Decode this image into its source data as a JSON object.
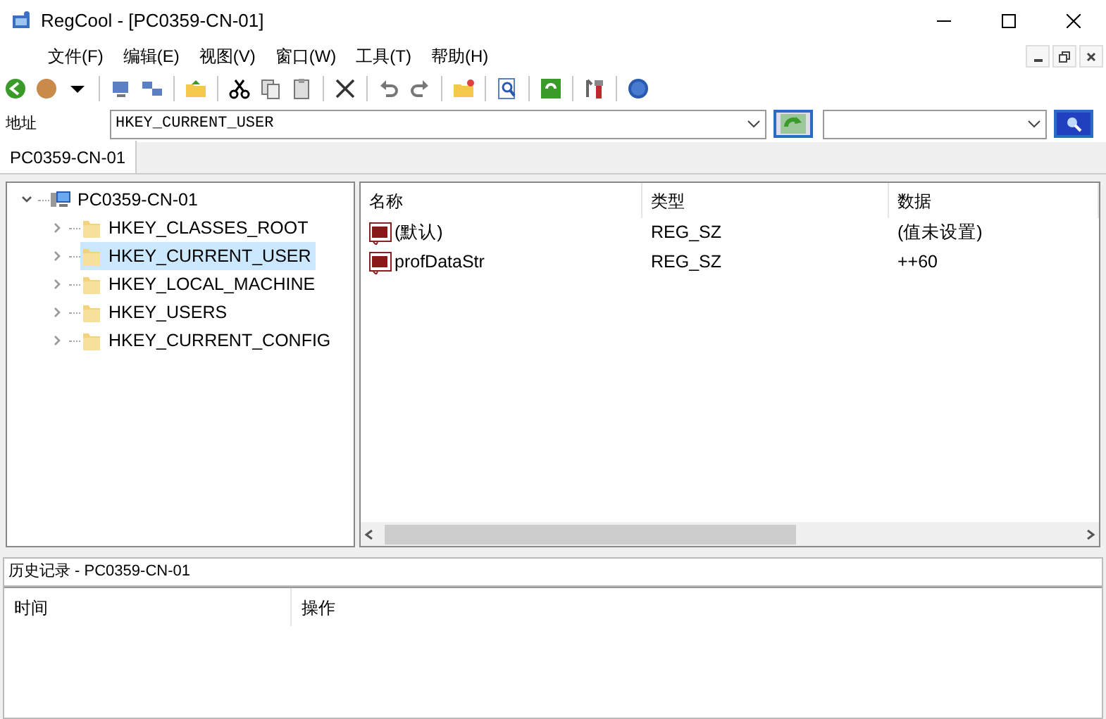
{
  "window": {
    "title": "RegCool - [PC0359-CN-01]"
  },
  "menu": [
    "文件(F)",
    "编辑(E)",
    "视图(V)",
    "窗口(W)",
    "工具(T)",
    "帮助(H)"
  ],
  "address": {
    "label": "地址",
    "value": "HKEY_CURRENT_USER"
  },
  "tabs": [
    {
      "label": "PC0359-CN-01",
      "selected": true
    }
  ],
  "tree": [
    {
      "label": "PC0359-CN-01",
      "kind": "computer",
      "expanded": true,
      "selected": false,
      "children": [
        {
          "label": "HKEY_CLASSES_ROOT",
          "kind": "folder",
          "expanded": false,
          "selected": false
        },
        {
          "label": "HKEY_CURRENT_USER",
          "kind": "folder",
          "expanded": false,
          "selected": true
        },
        {
          "label": "HKEY_LOCAL_MACHINE",
          "kind": "folder",
          "expanded": false,
          "selected": false
        },
        {
          "label": "HKEY_USERS",
          "kind": "folder",
          "expanded": false,
          "selected": false
        },
        {
          "label": "HKEY_CURRENT_CONFIG",
          "kind": "folder",
          "expanded": false,
          "selected": false
        }
      ]
    }
  ],
  "table": {
    "columns": [
      "名称",
      "类型",
      "数据"
    ],
    "rows": [
      [
        "(默认)",
        "REG_SZ",
        "(值未设置)"
      ],
      [
        "profDataStr",
        "REG_SZ",
        "++60"
      ]
    ]
  },
  "history": {
    "title": "历史记录 - PC0359-CN-01",
    "columns": [
      "时间",
      "操作"
    ]
  }
}
